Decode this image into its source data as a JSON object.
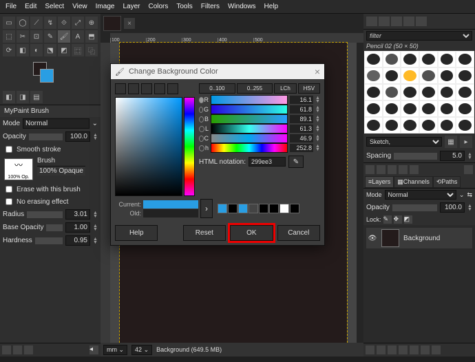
{
  "menubar": [
    "File",
    "Edit",
    "Select",
    "View",
    "Image",
    "Layer",
    "Colors",
    "Tools",
    "Filters",
    "Windows",
    "Help"
  ],
  "left": {
    "dock_title": "MyPaint Brush",
    "mode_label": "Mode",
    "mode_value": "Normal",
    "opacity_label": "Opacity",
    "opacity_value": "100.0",
    "smooth": "Smooth stroke",
    "brush_label": "Brush",
    "op_label": "100% Op.",
    "opaque": "100% Opaque",
    "erase": "Erase with this brush",
    "noerase": "No erasing effect",
    "radius_label": "Radius",
    "radius_value": "3.01",
    "baseop_label": "Base Opacity",
    "baseop_value": "1.00",
    "hard_label": "Hardness",
    "hard_value": "0.95"
  },
  "ruler": [
    "100",
    "200",
    "300",
    "400",
    "500"
  ],
  "status": {
    "unit": "mm",
    "zoom": "42",
    "mem": "Background (649.5 MB)"
  },
  "right": {
    "filter_placeholder": "filter",
    "brush_name": "Pencil 02 (50 × 50)",
    "cat": "Sketch,",
    "spacing_label": "Spacing",
    "spacing_value": "5.0",
    "tabs": {
      "layers": "Layers",
      "channels": "Channels",
      "paths": "Paths"
    },
    "mode_label": "Mode",
    "mode_value": "Normal",
    "opacity_label": "Opacity",
    "opacity_value": "100.0",
    "lock_label": "Lock:",
    "layer_name": "Background"
  },
  "dialog": {
    "title": "Change Background Color",
    "ranges": [
      "0..100",
      "0..255",
      "LCh",
      "HSV"
    ],
    "channels": [
      {
        "letter": "R",
        "value": "16.1",
        "sel": true,
        "grad": "grad-r"
      },
      {
        "letter": "G",
        "value": "61.8",
        "sel": false,
        "grad": "grad-g"
      },
      {
        "letter": "B",
        "value": "89.1",
        "sel": false,
        "grad": "grad-b"
      },
      {
        "letter": "L",
        "value": "61.3",
        "sel": false,
        "grad": "grad-lc"
      },
      {
        "letter": "C",
        "value": "46.9",
        "sel": false,
        "grad": "grad-cc"
      },
      {
        "letter": "h",
        "value": "252.8",
        "sel": false,
        "grad": "grad-h"
      }
    ],
    "html_label": "HTML notation:",
    "html_value": "299ee3",
    "current_label": "Current:",
    "old_label": "Old:",
    "palette": [
      "#299ee3",
      "#000",
      "#299ee3",
      "#444",
      "#000",
      "#000",
      "#fff",
      "#000"
    ],
    "btn_help": "Help",
    "btn_reset": "Reset",
    "btn_ok": "OK",
    "btn_cancel": "Cancel"
  }
}
